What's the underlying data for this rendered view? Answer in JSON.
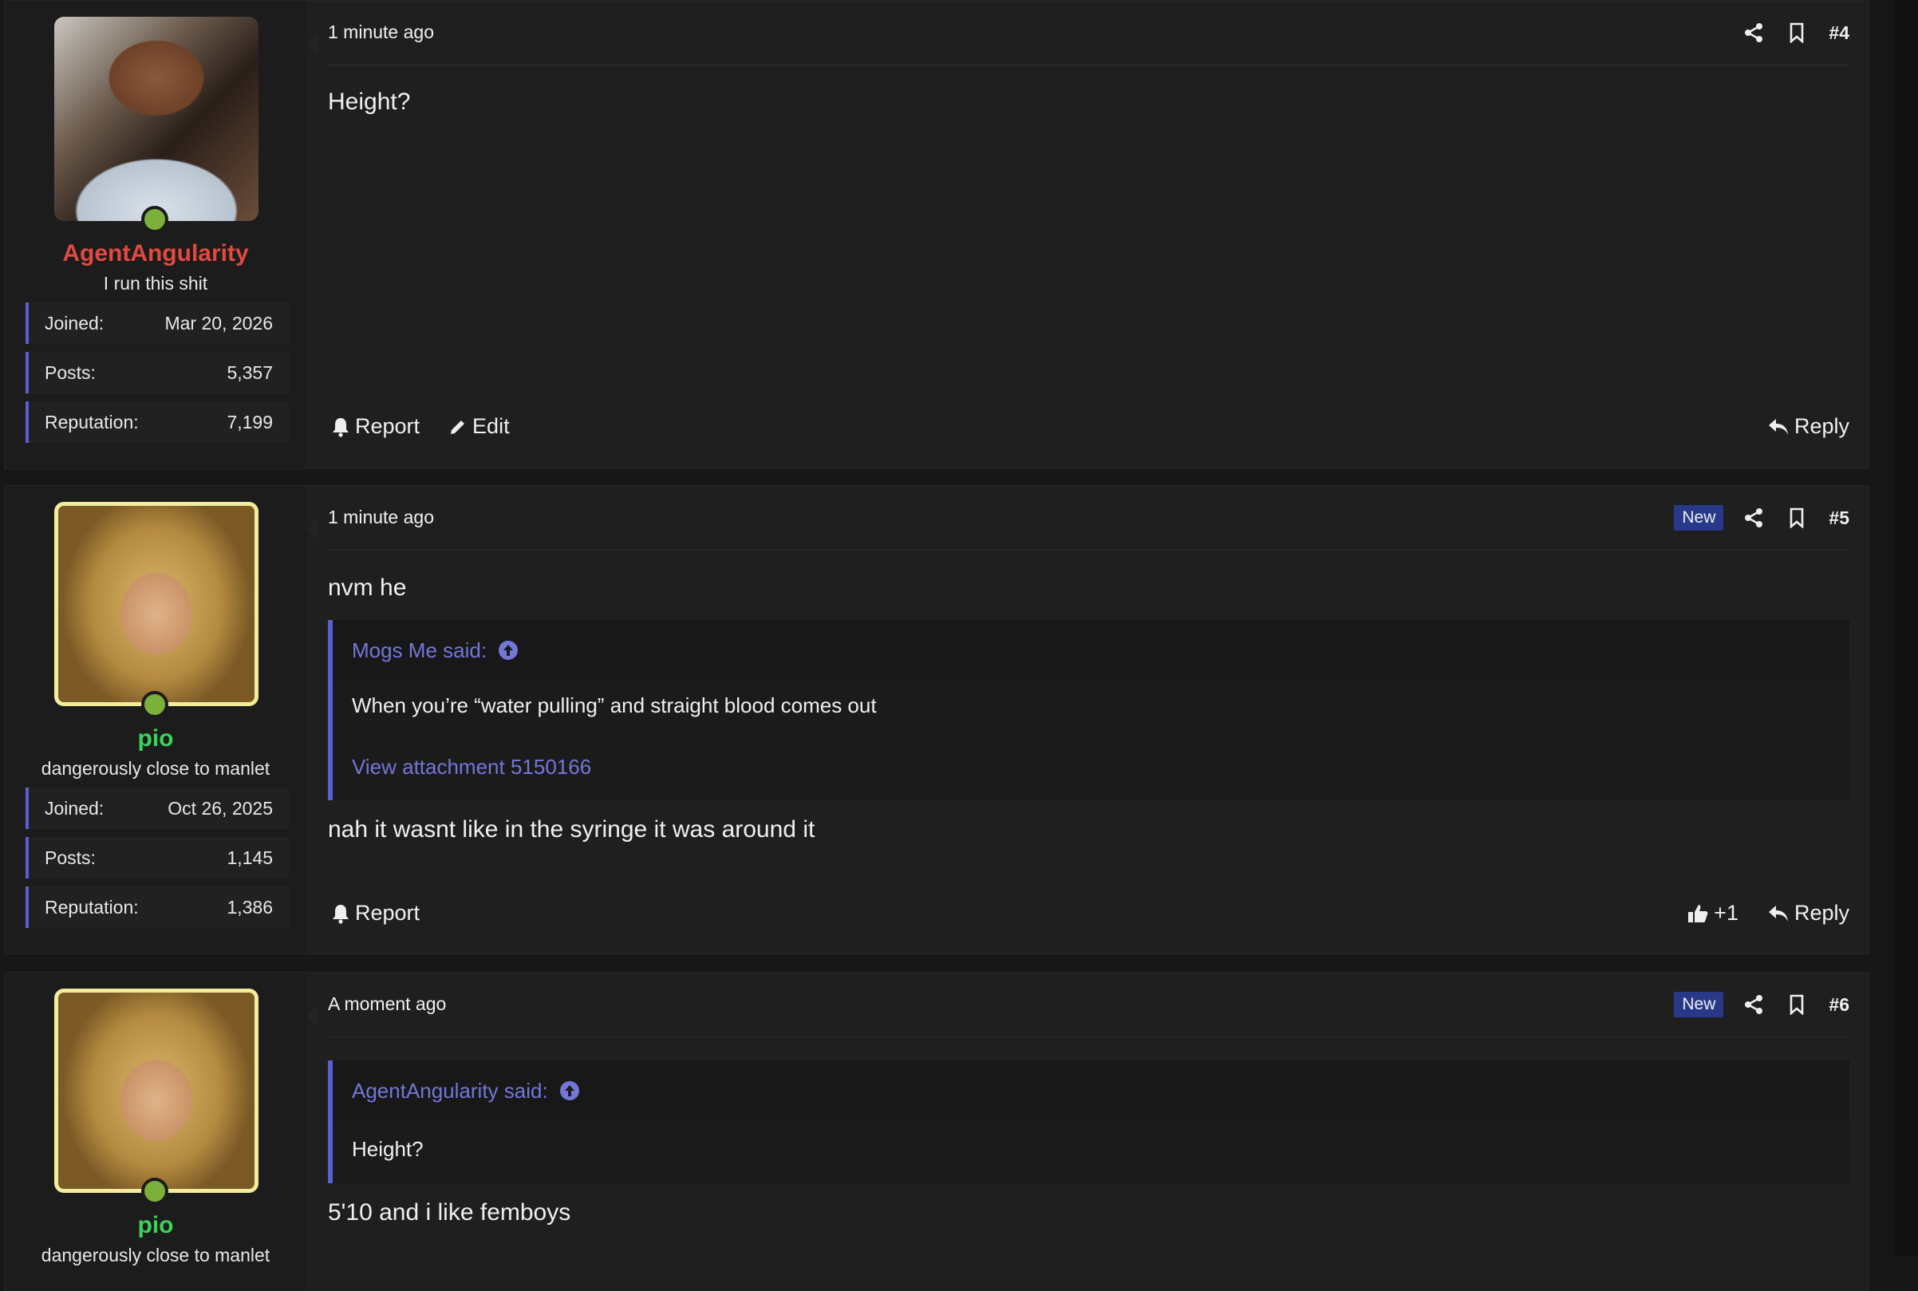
{
  "posts": [
    {
      "user": {
        "name": "AgentAngularity",
        "title": "I run this shit",
        "joined_label": "Joined:",
        "joined": "Mar 20, 2026",
        "posts_label": "Posts:",
        "posts": "5,357",
        "rep_label": "Reputation:",
        "rep": "7,199"
      },
      "time": "1 minute ago",
      "number": "#4",
      "message": "Height?",
      "actions": {
        "report": "Report",
        "edit": "Edit",
        "reply": "Reply"
      }
    },
    {
      "user": {
        "name": "pio",
        "title": "dangerously close to manlet",
        "joined_label": "Joined:",
        "joined": "Oct 26, 2025",
        "posts_label": "Posts:",
        "posts": "1,145",
        "rep_label": "Reputation:",
        "rep": "1,386"
      },
      "time": "1 minute ago",
      "badge": "New",
      "number": "#5",
      "message_before": "nvm he",
      "quote": {
        "author": "Mogs Me said:",
        "text": "When you’re “water pulling” and straight blood comes out",
        "link": "View attachment 5150166"
      },
      "message_after": "nah it wasnt like in the syringe it was around it",
      "actions": {
        "report": "Report",
        "like_count": "+1",
        "reply": "Reply"
      }
    },
    {
      "user": {
        "name": "pio",
        "title": "dangerously close to manlet"
      },
      "time": "A moment ago",
      "badge": "New",
      "number": "#6",
      "quote": {
        "author": "AgentAngularity said:",
        "text": "Height?"
      },
      "message_after": "5'10 and i like femboys"
    }
  ],
  "colors": {
    "accent": "#5b5fd3",
    "username_red": "#e2493f",
    "username_green": "#3bd35a",
    "badge_new": "#28398a"
  }
}
